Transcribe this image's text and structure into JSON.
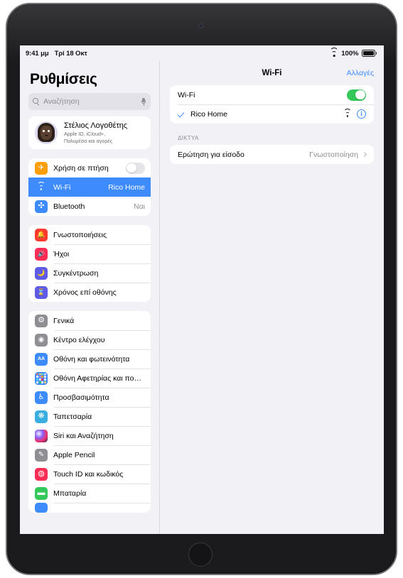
{
  "status_bar": {
    "time": "9:41 μμ",
    "date": "Τρί 18 Οκτ",
    "wifi_icon": "wifi-icon",
    "battery_percent": "100%",
    "battery_icon": "battery-full-icon"
  },
  "sidebar": {
    "title": "Ρυθμίσεις",
    "search": {
      "placeholder": "Αναζήτηση",
      "search_icon": "search-icon",
      "mic_icon": "microphone-icon"
    },
    "account": {
      "name": "Στέλιος Λογοθέτης",
      "subtitle_line1": "Apple ID, iCloud+,",
      "subtitle_line2": "Πολυμέσα και αγορές",
      "avatar_icon": "memoji-avatar"
    },
    "groups": [
      {
        "rows": [
          {
            "label": "Χρήση σε πτήση",
            "value": "",
            "icon": "airplane-icon",
            "icon_color": "#ff9f0a",
            "glyph": "✈",
            "control": "toggle-off",
            "selected": false
          },
          {
            "label": "Wi-Fi",
            "value": "Rico Home",
            "icon": "wifi-icon",
            "icon_color": "#3d8bfd",
            "glyph": "",
            "control": "",
            "selected": true
          },
          {
            "label": "Bluetooth",
            "value": "Ναι",
            "icon": "bluetooth-icon",
            "icon_color": "#3d8bfd",
            "glyph": "✣",
            "control": "",
            "selected": false
          }
        ]
      },
      {
        "rows": [
          {
            "label": "Γνωστοποιήσεις",
            "value": "",
            "icon": "notifications-icon",
            "icon_color": "#ff3b30",
            "glyph": "🔔",
            "control": "",
            "selected": false
          },
          {
            "label": "Ήχοι",
            "value": "",
            "icon": "sounds-icon",
            "icon_color": "#fc2d55",
            "glyph": "🔊",
            "control": "",
            "selected": false
          },
          {
            "label": "Συγκέντρωση",
            "value": "",
            "icon": "focus-moon-icon",
            "icon_color": "#5e5ce6",
            "glyph": "🌙",
            "control": "",
            "selected": false
          },
          {
            "label": "Χρόνος επί οθόνης",
            "value": "",
            "icon": "screen-time-icon",
            "icon_color": "#5e5ce6",
            "glyph": "⌛",
            "control": "",
            "selected": false
          }
        ]
      },
      {
        "rows": [
          {
            "label": "Γενικά",
            "value": "",
            "icon": "general-gear-icon",
            "icon_color": "#8e8e93",
            "glyph": "⚙",
            "control": "",
            "selected": false
          },
          {
            "label": "Κέντρο ελέγχου",
            "value": "",
            "icon": "control-center-icon",
            "icon_color": "#8e8e93",
            "glyph": "◉",
            "control": "",
            "selected": false
          },
          {
            "label": "Οθόνη και φωτεινότητα",
            "value": "",
            "icon": "display-brightness-icon",
            "icon_color": "#3d8bfd",
            "glyph": "AA",
            "control": "",
            "selected": false
          },
          {
            "label": "Οθόνη Αφετηρίας και πο…",
            "value": "",
            "icon": "home-screen-icon",
            "icon_color": "#3d8bfd",
            "glyph": "grid",
            "control": "",
            "selected": false
          },
          {
            "label": "Προσβασιμότητα",
            "value": "",
            "icon": "accessibility-icon",
            "icon_color": "#3d8bfd",
            "glyph": "♿",
            "control": "",
            "selected": false
          },
          {
            "label": "Ταπετσαρία",
            "value": "",
            "icon": "wallpaper-icon",
            "icon_color": "#3aaee0",
            "glyph": "❋",
            "control": "",
            "selected": false
          },
          {
            "label": "Siri και Αναζήτηση",
            "value": "",
            "icon": "siri-icon",
            "icon_color": "#2b1a4a",
            "glyph": "siri",
            "control": "",
            "selected": false
          },
          {
            "label": "Apple Pencil",
            "value": "",
            "icon": "apple-pencil-icon",
            "icon_color": "#8e8e93",
            "glyph": "✎",
            "control": "",
            "selected": false
          },
          {
            "label": "Touch ID και κωδικός",
            "value": "",
            "icon": "touch-id-icon",
            "icon_color": "#fc2d55",
            "glyph": "◍",
            "control": "",
            "selected": false
          },
          {
            "label": "Μπαταρία",
            "value": "",
            "icon": "battery-icon",
            "icon_color": "#34c759",
            "glyph": "▬",
            "control": "",
            "selected": false
          }
        ]
      }
    ]
  },
  "detail": {
    "title": "Wi-Fi",
    "action_label": "Αλλαγές",
    "wifi_toggle": {
      "label": "Wi-Fi",
      "state": "on"
    },
    "current_network": {
      "name": "Rico Home",
      "connected_check": "checkmark-icon",
      "signal_icon": "wifi-signal-icon",
      "info_icon": "info-icon"
    },
    "networks_section": {
      "header": "ΔΙΚΤΥΑ",
      "rows": [
        {
          "label": "Ερώτηση για είσοδο",
          "value": "Γνωστοποίηση",
          "chevron": "chevron-right-icon"
        }
      ]
    }
  },
  "colors": {
    "accent": "#3d8bfd",
    "toggle_on": "#34c759",
    "background": "#f2f1f6",
    "card": "#ffffff",
    "secondary_text": "#8c8c93"
  }
}
